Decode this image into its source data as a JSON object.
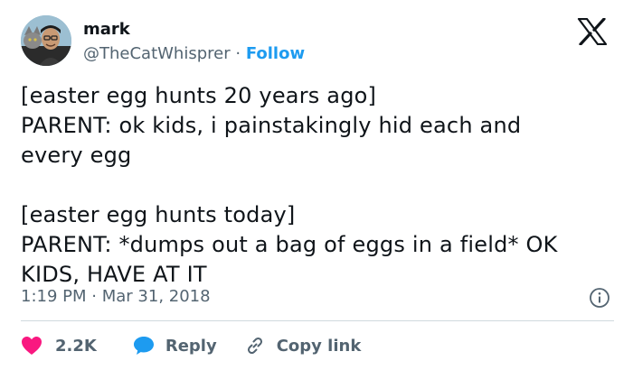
{
  "author": {
    "name": "mark",
    "handle": "@TheCatWhisprer",
    "separator": "·",
    "follow_label": "Follow"
  },
  "tweet": {
    "text": "[easter egg hunts 20 years ago]\nPARENT: ok kids, i painstakingly hid each and\nevery egg\n\n[easter egg hunts today]\nPARENT: *dumps out a bag of eggs in a field* OK\nKIDS, HAVE AT IT",
    "time": "1:19 PM",
    "meta_separator": "·",
    "date": "Mar 31, 2018"
  },
  "actions": {
    "like_count": "2.2K",
    "reply_label": "Reply",
    "copy_link_label": "Copy link"
  },
  "icons": {
    "brand": "x-logo-icon",
    "info": "info-icon",
    "like": "heart-icon",
    "reply": "speech-bubble-icon",
    "copy": "link-icon"
  },
  "colors": {
    "follow": "#1d9bf0",
    "like": "#f91880",
    "reply": "#1d9bf0",
    "secondary_text": "#536471"
  }
}
